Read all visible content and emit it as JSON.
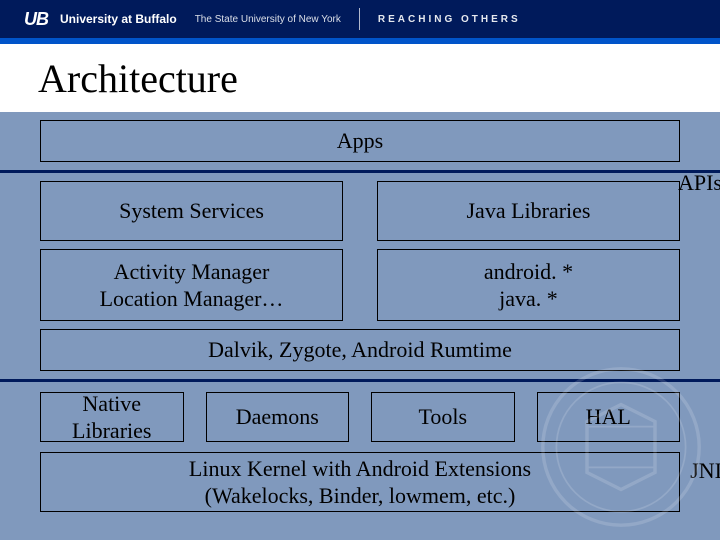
{
  "brand": {
    "mark": "UB",
    "name": "University at Buffalo",
    "subtitle": "The State University of New York",
    "tagline": "REACHING OTHERS"
  },
  "title": "Architecture",
  "labels": {
    "apis": "APIs",
    "jni": "JNI"
  },
  "layers": {
    "apps": "Apps",
    "system_services": "System Services",
    "java_libraries": "Java Libraries",
    "activity_manager": "Activity Manager\nLocation Manager…",
    "android_packages": "android. *\njava. *",
    "dalvik": "Dalvik, Zygote, Android Rumtime",
    "native_libraries": "Native Libraries",
    "daemons": "Daemons",
    "tools": "Tools",
    "hal": "HAL",
    "kernel": "Linux Kernel with Android Extensions\n(Wakelocks, Binder, lowmem, etc.)"
  }
}
